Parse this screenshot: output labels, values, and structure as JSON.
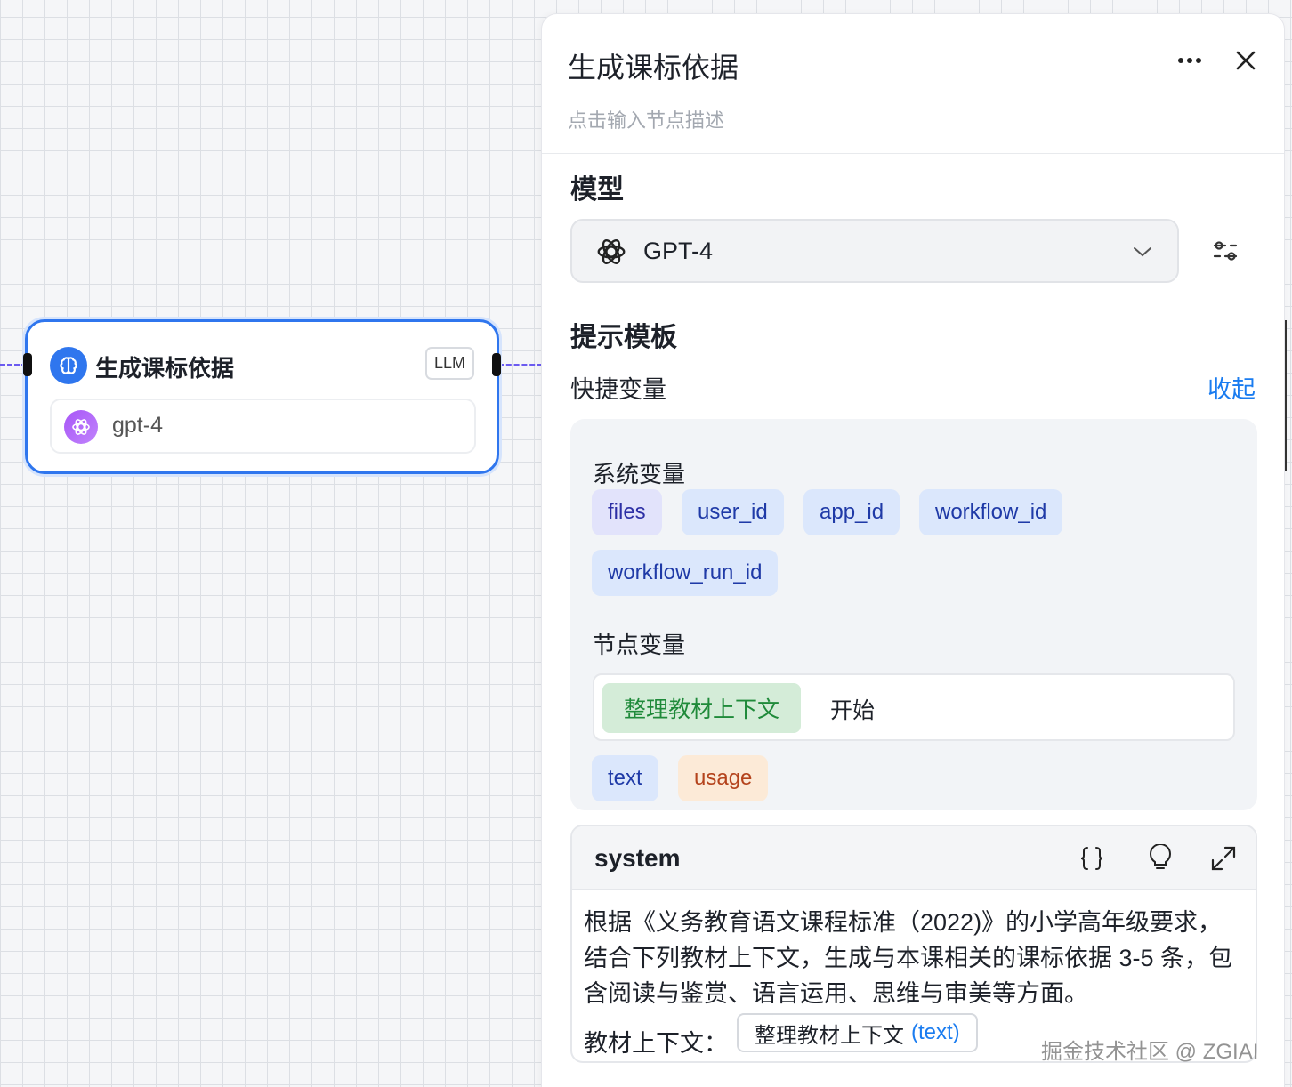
{
  "canvas": {
    "node": {
      "title": "生成课标依据",
      "badge": "LLM",
      "model": "gpt-4",
      "icon": "brain-icon",
      "model_icon": "openai-icon"
    }
  },
  "panel": {
    "title": "生成课标依据",
    "description_placeholder": "点击输入节点描述",
    "model_section": {
      "label": "模型",
      "selected_model": "GPT-4"
    },
    "prompt_section": {
      "label": "提示模板",
      "shortcut_vars_label": "快捷变量",
      "collapse_label": "收起",
      "system_vars": {
        "heading": "系统变量",
        "chips": [
          "files",
          "user_id",
          "app_id",
          "workflow_id",
          "workflow_run_id"
        ]
      },
      "node_vars": {
        "heading": "节点变量",
        "tabs": [
          "整理教材上下文",
          "开始"
        ],
        "active_tab": "整理教材上下文",
        "chips": [
          "text",
          "usage"
        ]
      }
    },
    "system_prompt": {
      "title": "system",
      "text": "根据《义务教育语文课程标准（2022)》的小学高年级要求，结合下列教材上下文，生成与本课相关的课标依据 3-5 条，包含阅读与鉴赏、语言运用、思维与审美等方面。",
      "context_label": "教材上下文：",
      "context_var_name": "整理教材上下文",
      "context_var_type": "(text)"
    }
  },
  "watermark": "掘金技术社区 @ ZGIAI",
  "colors": {
    "accent": "#2f76ee",
    "link": "#1a7cf0",
    "edge": "#6b5bf0"
  }
}
